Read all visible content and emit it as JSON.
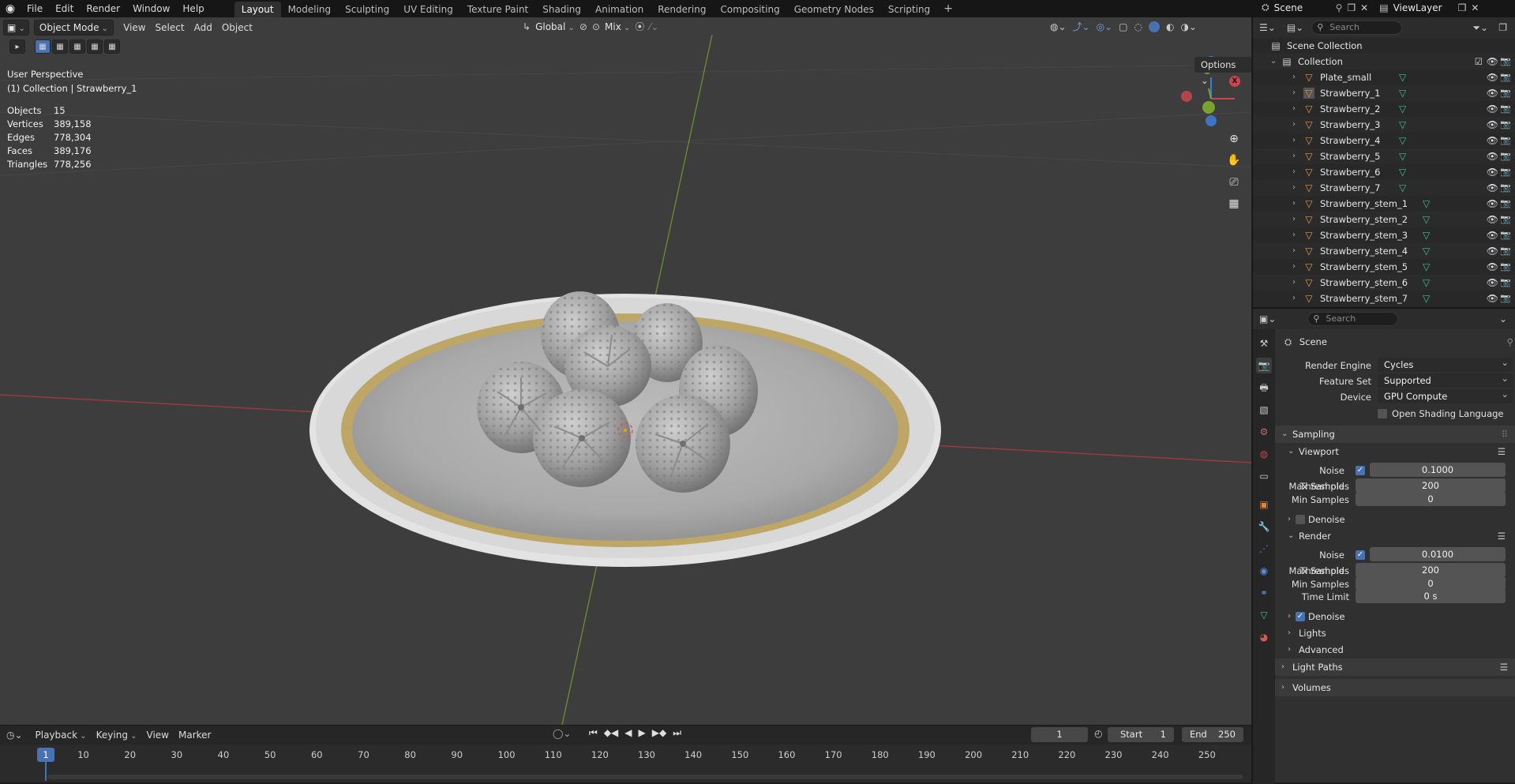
{
  "topbar": {
    "menus": [
      "File",
      "Edit",
      "Render",
      "Window",
      "Help"
    ],
    "workspaces": [
      "Layout",
      "Modeling",
      "Sculpting",
      "UV Editing",
      "Texture Paint",
      "Shading",
      "Animation",
      "Rendering",
      "Compositing",
      "Geometry Nodes",
      "Scripting"
    ],
    "active_workspace": "Layout",
    "scene_name": "Scene",
    "viewlayer_name": "ViewLayer"
  },
  "viewport": {
    "mode": "Object Mode",
    "menus": [
      "View",
      "Select",
      "Add",
      "Object"
    ],
    "transform_orientation": "Global",
    "snap_mode": "Mix",
    "options_label": "Options",
    "perspective": "User Perspective",
    "context": "(1) Collection | Strawberry_1",
    "stats": [
      {
        "k": "Objects",
        "v": "15"
      },
      {
        "k": "Vertices",
        "v": "389,158"
      },
      {
        "k": "Edges",
        "v": "778,304"
      },
      {
        "k": "Faces",
        "v": "389,176"
      },
      {
        "k": "Triangles",
        "v": "778,256"
      }
    ],
    "gizmo": {
      "x": "X",
      "y": "Y",
      "z": "Z"
    },
    "colors": {
      "x_axis": "#c7474f",
      "y_axis": "#7aa232",
      "z_axis": "#3c7ed6",
      "bg": "#3d3d3d"
    }
  },
  "timeline": {
    "menus": [
      "Playback",
      "Keying",
      "View",
      "Marker"
    ],
    "current_frame": "1",
    "start_label": "Start",
    "start": "1",
    "end_label": "End",
    "end": "250",
    "ticks": [
      "1",
      "10",
      "20",
      "30",
      "40",
      "50",
      "60",
      "70",
      "80",
      "90",
      "100",
      "110",
      "120",
      "130",
      "140",
      "150",
      "160",
      "170",
      "180",
      "190",
      "200",
      "210",
      "220",
      "230",
      "240",
      "250"
    ]
  },
  "outliner": {
    "search_placeholder": "Search",
    "scene_collection": "Scene Collection",
    "collection": "Collection",
    "objects": [
      "Plate_small",
      "Strawberry_1",
      "Strawberry_2",
      "Strawberry_3",
      "Strawberry_4",
      "Strawberry_5",
      "Strawberry_6",
      "Strawberry_7",
      "Strawberry_stem_1",
      "Strawberry_stem_2",
      "Strawberry_stem_3",
      "Strawberry_stem_4",
      "Strawberry_stem_5",
      "Strawberry_stem_6",
      "Strawberry_stem_7"
    ]
  },
  "properties": {
    "search_placeholder": "Search",
    "context": "Scene",
    "render_engine_label": "Render Engine",
    "render_engine": "Cycles",
    "feature_set_label": "Feature Set",
    "feature_set": "Supported",
    "device_label": "Device",
    "device": "GPU Compute",
    "osl_label": "Open Shading Language",
    "sampling": "Sampling",
    "viewport_panel": "Viewport",
    "noise_threshold_label": "Noise Threshold",
    "viewport_noise_threshold": "0.1000",
    "max_samples_label": "Max Samples",
    "viewport_max_samples": "200",
    "min_samples_label": "Min Samples",
    "viewport_min_samples": "0",
    "denoise_label": "Denoise",
    "render_panel": "Render",
    "render_noise_threshold": "0.0100",
    "render_max_samples": "200",
    "render_min_samples": "0",
    "time_limit_label": "Time Limit",
    "time_limit": "0 s",
    "lights": "Lights",
    "advanced": "Advanced",
    "light_paths": "Light Paths",
    "volumes": "Volumes"
  }
}
